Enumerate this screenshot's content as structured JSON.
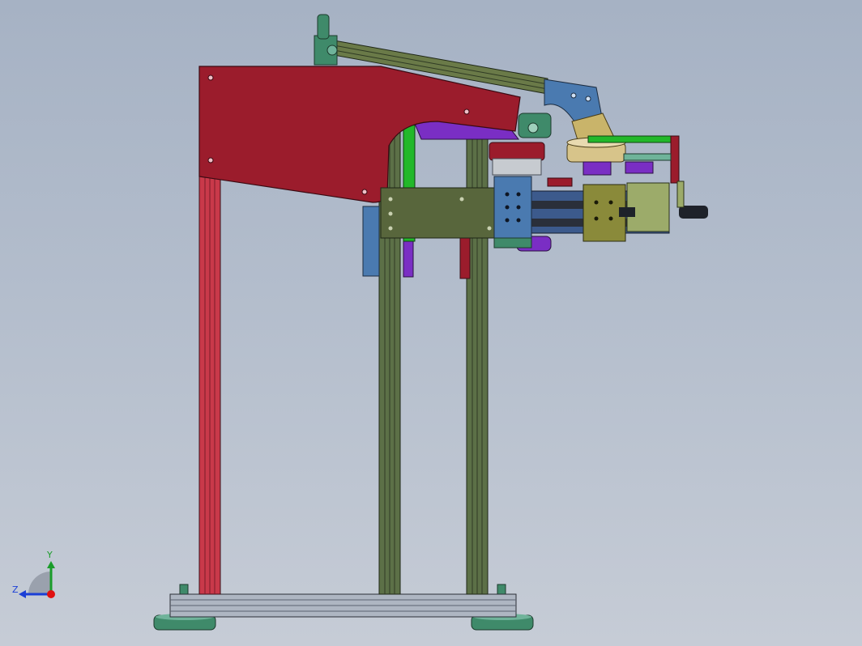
{
  "viewport": {
    "background_top": "#a6b2c4",
    "background_bottom": "#c6ccd6"
  },
  "triad": {
    "y_label": "Y",
    "z_label": "Z",
    "x_axis_color": "#e01010",
    "y_axis_color": "#1a9c2a",
    "z_axis_color": "#1b3fd6"
  },
  "model": {
    "frame_color": "#5c7047",
    "plate_color": "#9b1c2c",
    "base_color": "#aeb6c2",
    "foot_color": "#3f8a6a",
    "bracket_color": "#4a7ab0",
    "motor_color": "#b9a060",
    "purple_color": "#7a2ec4",
    "green_color": "#22b82a"
  }
}
